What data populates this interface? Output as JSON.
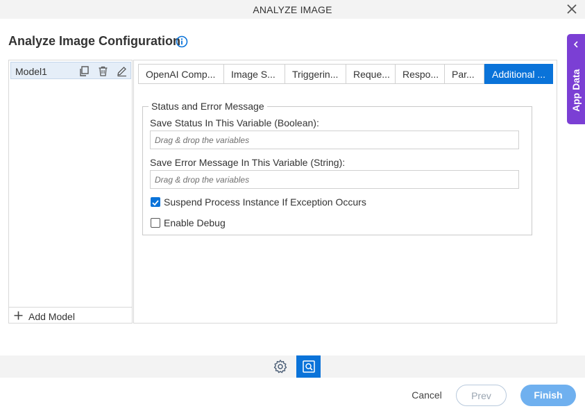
{
  "window": {
    "title": "ANALYZE IMAGE"
  },
  "header": {
    "title": "Analyze Image Configuration",
    "info_icon": "info-circle-icon"
  },
  "app_data": {
    "label": "App Data",
    "color": "#7b3fd4"
  },
  "models": {
    "items": [
      {
        "name": "Model1"
      }
    ],
    "add_label": "Add Model"
  },
  "tabs": [
    {
      "label": "OpenAI Comp..."
    },
    {
      "label": "Image S..."
    },
    {
      "label": "Triggerin..."
    },
    {
      "label": "Reque..."
    },
    {
      "label": "Respo..."
    },
    {
      "label": "Par..."
    },
    {
      "label": "Additional ...",
      "active": true
    }
  ],
  "status_section": {
    "legend": "Status and Error Message",
    "status_label": "Save Status In This Variable (Boolean):",
    "status_placeholder": "Drag & drop the variables",
    "error_label": "Save Error Message In This Variable (String):",
    "error_placeholder": "Drag & drop the variables",
    "suspend_label": "Suspend Process Instance If Exception Occurs",
    "suspend_checked": true,
    "debug_label": "Enable Debug",
    "debug_checked": false
  },
  "footer": {
    "cancel": "Cancel",
    "prev": "Prev",
    "finish": "Finish"
  },
  "colors": {
    "accent": "#0a73d9",
    "finish": "#6fb0ef"
  }
}
